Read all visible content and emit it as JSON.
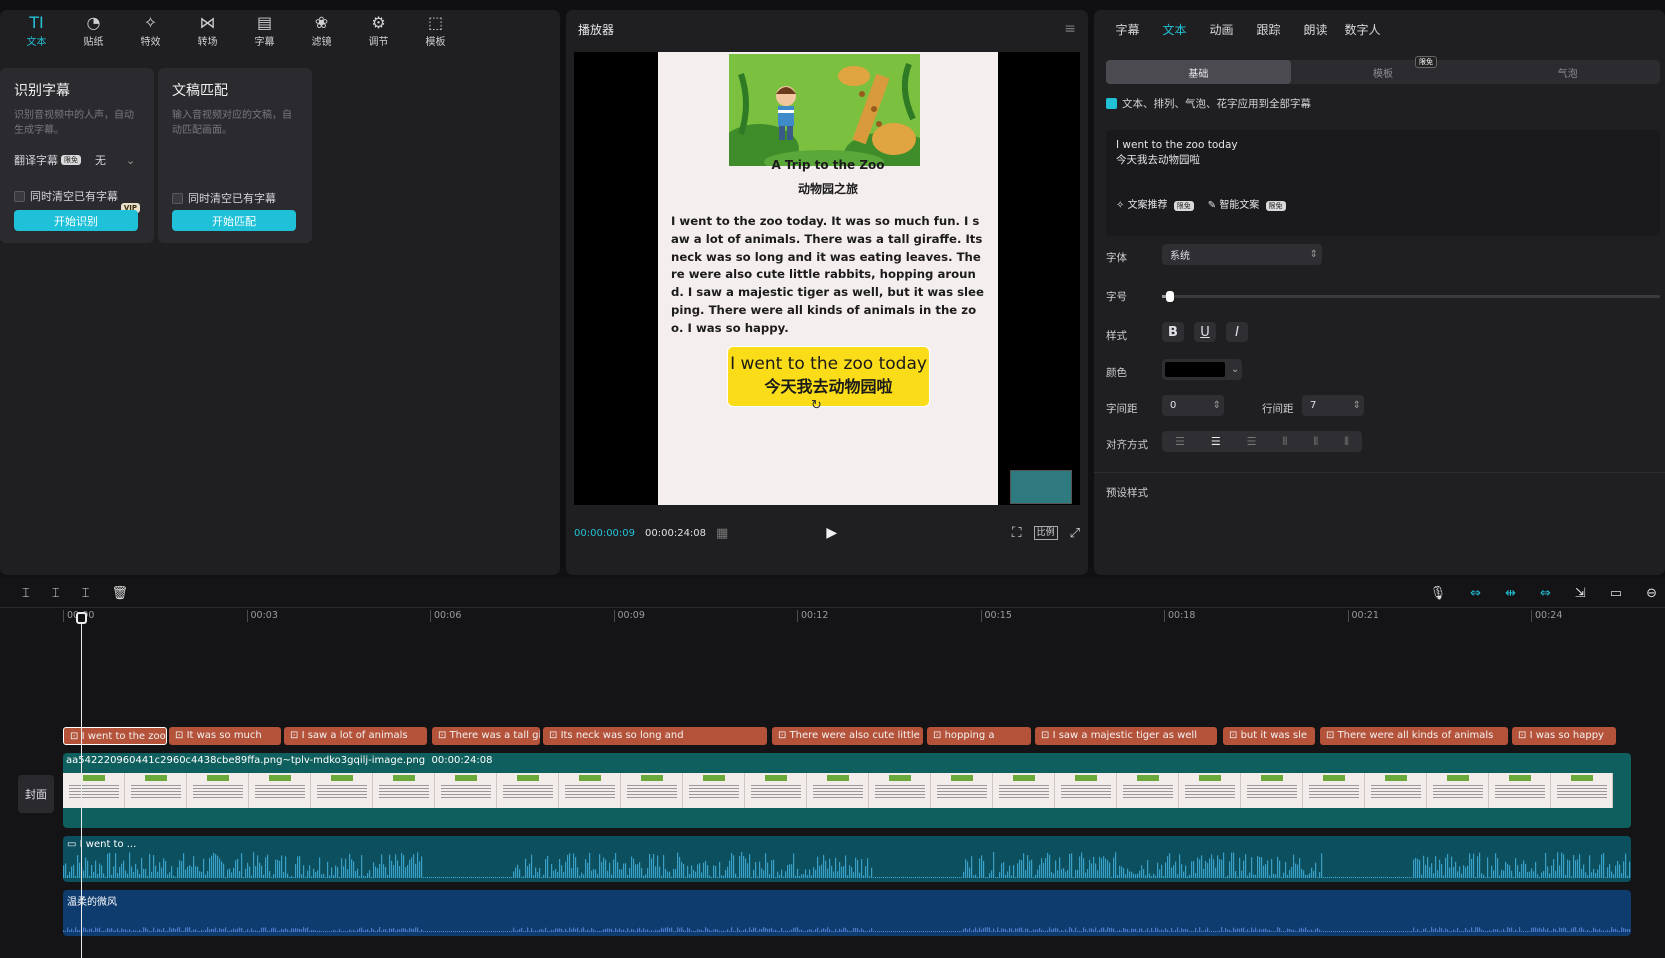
{
  "toolbar": {
    "tools": [
      {
        "icon": "text-icon",
        "label": "文本",
        "active": true
      },
      {
        "icon": "sticker-icon",
        "label": "贴纸"
      },
      {
        "icon": "effects-icon",
        "label": "特效"
      },
      {
        "icon": "transition-icon",
        "label": "转场"
      },
      {
        "icon": "subtitle-icon",
        "label": "字幕"
      },
      {
        "icon": "filter-icon",
        "label": "滤镜"
      },
      {
        "icon": "adjust-icon",
        "label": "调节"
      },
      {
        "icon": "template-icon",
        "label": "模板"
      }
    ]
  },
  "cards": {
    "recognize": {
      "title": "识别字幕",
      "desc": "识别音视频中的人声，自动生成字幕。",
      "translate_label": "翻译字幕",
      "translate_value": "无",
      "clear_label": "同时清空已有字幕",
      "button": "开始识别",
      "vip": "VIP"
    },
    "match": {
      "title": "文稿匹配",
      "desc": "输入音视频对应的文稿，自动匹配画面。",
      "clear_label": "同时清空已有字幕",
      "button": "开始匹配"
    }
  },
  "player": {
    "title": "播放器",
    "doc_title": "A Trip to the Zoo",
    "doc_subtitle": "动物园之旅",
    "doc_body": "I went to the zoo today. It was so much fun. I saw a lot of animals. There was a tall giraffe. Its neck was so long and it was eating leaves. There were also cute little rabbits, hopping around. I saw a majestic tiger as well, but it was sleeping. There were all kinds of animals in the zoo. I was so happy.",
    "caption_en": "I went to the zoo today",
    "caption_zh": "今天我去动物园啦",
    "time_current": "00:00:00:09",
    "time_total": "00:00:24:08",
    "ratio_label": "比例"
  },
  "inspector": {
    "tabs": [
      "字幕",
      "文本",
      "动画",
      "跟踪",
      "朗读",
      "数字人"
    ],
    "active_tab": "文本",
    "segments": [
      "基础",
      "模板",
      "气泡"
    ],
    "free_badge": "限免",
    "apply_all": "文本、排列、气泡、花字应用到全部字幕",
    "text_line1": "I went to the zoo today",
    "text_line2": "今天我去动物园啦",
    "ai_recommend": "文案推荐",
    "ai_smart": "智能文案",
    "font_label": "字体",
    "font_value": "系统",
    "size_label": "字号",
    "size_value": 0.01,
    "style_label": "样式",
    "color_label": "颜色",
    "color_value": "#000000",
    "spacing_label": "字间距",
    "spacing_value": "0",
    "line_label": "行间距",
    "line_value": "7",
    "align_label": "对齐方式",
    "preset_label": "预设样式"
  },
  "timeline": {
    "ticks": [
      "00:00",
      "00:03",
      "00:06",
      "00:09",
      "00:12",
      "00:15",
      "00:18",
      "00:21",
      "00:24"
    ],
    "clips": [
      "I went to the zoo",
      "It was so much",
      "I saw a lot of animals",
      "There was a tall gi",
      "Its neck was so long and",
      "There were also cute little r",
      "hopping a",
      "I saw a majestic tiger as well",
      "but it was sle",
      "There were all kinds of animals",
      "I was so happy"
    ],
    "cover_label": "封面",
    "video_name": "aa542220960441c2960c4438cbe89ffa.png~tplv-mdko3gqilj-image.png",
    "video_duration": "00:00:24:08",
    "voice_label": "I went to ...",
    "music_label": "温柔的微风"
  }
}
